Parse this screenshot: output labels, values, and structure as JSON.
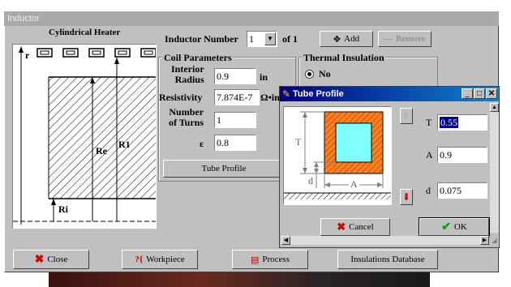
{
  "window": {
    "title": "Inductor"
  },
  "diagram": {
    "title": "Cylindrical Heater",
    "labels": {
      "r": "r",
      "re": "Re",
      "r1": "R1",
      "ri": "Ri"
    }
  },
  "inductor": {
    "label": "Inductor Number",
    "number": "1",
    "of_label": "of 1",
    "add_label": "Add",
    "remove_label": "Remove"
  },
  "coil": {
    "group_title": "Coil Parameters",
    "interior_radius_label_1": "Interior",
    "interior_radius_label_2": "Radius",
    "interior_radius_value": "0.9",
    "interior_radius_unit": "in",
    "resistivity_label": "Resistivity",
    "resistivity_value": "7.874E-7",
    "resistivity_unit": "Ω•in",
    "turns_label_1": "Number",
    "turns_label_2": "of Turns",
    "turns_value": "1",
    "epsilon_label": "ε",
    "epsilon_value": "0.8",
    "tube_profile_button": "Tube Profile"
  },
  "thermal": {
    "group_title": "Thermal Insulation",
    "option_no": "No"
  },
  "tube_profile": {
    "title": "Tube Profile",
    "dim_t": "T",
    "dim_d": "d",
    "dim_a": "A",
    "t_label": "T",
    "t_value": "0.55",
    "a_label": "A",
    "a_value": "0.9",
    "d_label": "d",
    "d_value": "0.075",
    "cancel_label": "Cancel",
    "ok_label": "OK"
  },
  "footer": {
    "close_label": "Close",
    "workpiece_label": "Workpiece",
    "process_label": "Process",
    "insulations_label": "Insulations Database"
  },
  "colors": {
    "tube_fill": "#ff7f1e",
    "tube_hole": "#7fffff",
    "titlebar_active": "#000080"
  }
}
